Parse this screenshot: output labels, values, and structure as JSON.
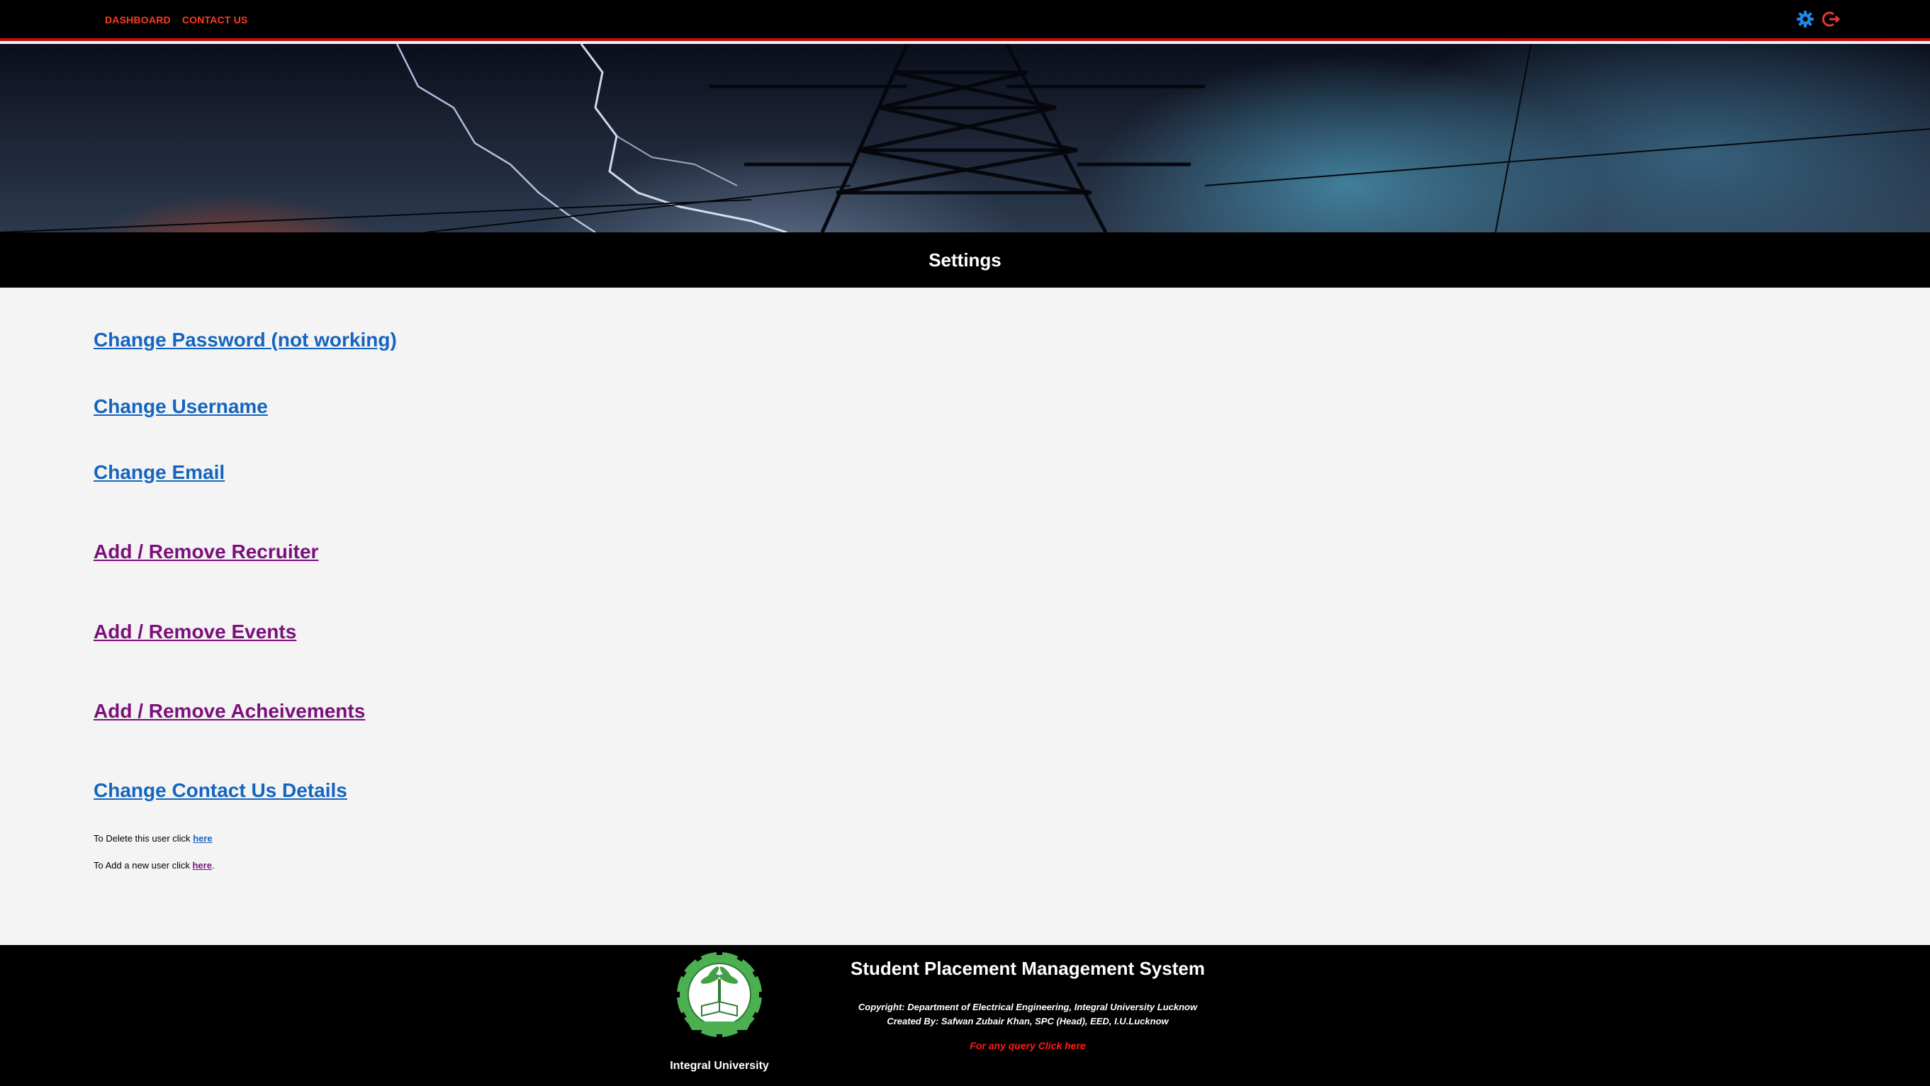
{
  "nav": {
    "dashboard": "DASHBOARD",
    "contact": "CONTACT US"
  },
  "icons": {
    "settings": "gear-icon",
    "logout": "logout-icon"
  },
  "page": {
    "title": "Settings"
  },
  "settings_links": {
    "change_password": "Change Password (not working)",
    "change_username": "Change Username",
    "change_email": "Change Email",
    "recruiter": "Add / Remove Recruiter",
    "events": "Add / Remove Events",
    "achievements": "Add / Remove Acheivements",
    "contact_details": "Change Contact Us Details"
  },
  "user_actions": {
    "delete_prefix": "To Delete this user click",
    "delete_link": "here",
    "add_prefix": "To Add a new user click",
    "add_link": "here",
    "add_suffix": "."
  },
  "footer": {
    "university": "Integral University",
    "system_title": "Student Placement Management System",
    "copyright": "Copyright: Department of Electrical Engineering, Integral University Lucknow",
    "created_by": "Created By: Safwan Zubair Khan, SPC (Head), EED, I.U.Lucknow",
    "query": "For any query Click here",
    "logo_text": "INTEGRAL UNIVERSITY LUCKNOW"
  },
  "colors": {
    "accent_red": "#c61010",
    "nav_text": "#ff3b1f",
    "link_blue": "#1565c0",
    "link_visited": "#7b0f7b"
  }
}
